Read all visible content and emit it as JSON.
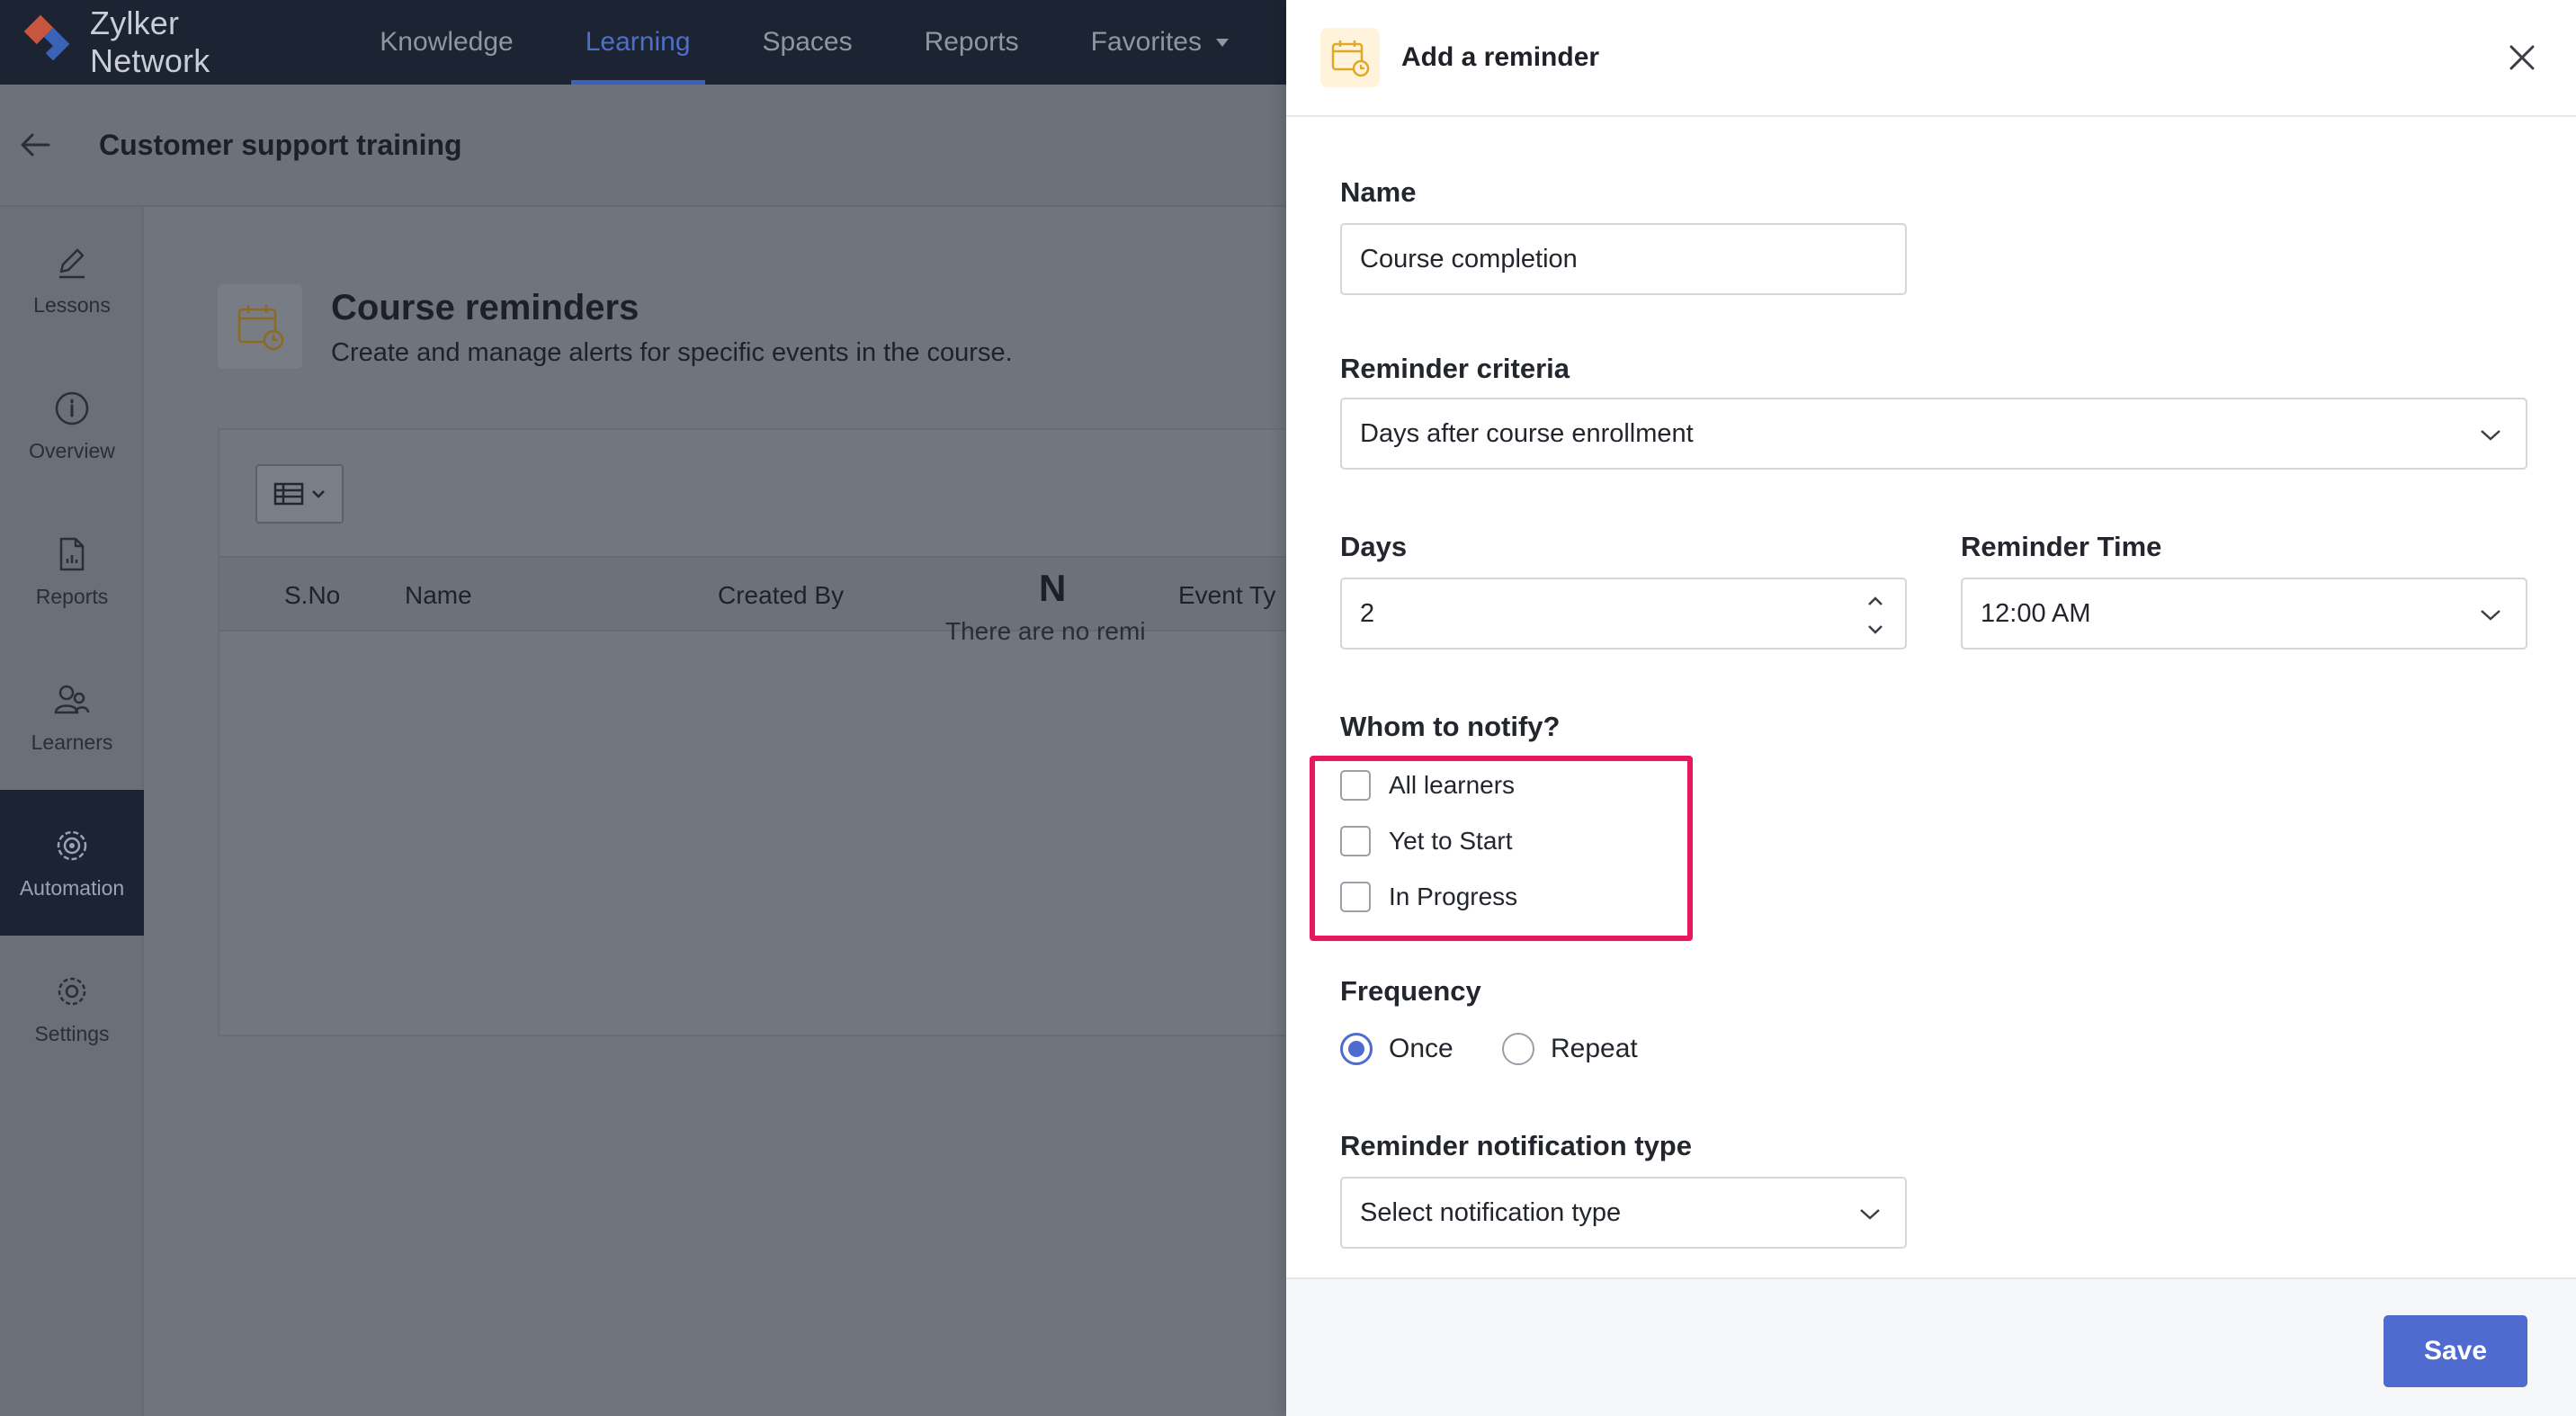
{
  "app": {
    "brand": "Zylker Network",
    "nav_tabs": [
      "Knowledge",
      "Learning",
      "Spaces",
      "Reports",
      "Favorites"
    ],
    "active_tab": "Learning"
  },
  "subheader": {
    "title": "Customer support training"
  },
  "sidebar": {
    "items": [
      {
        "label": "Lessons",
        "icon": "pencil-icon"
      },
      {
        "label": "Overview",
        "icon": "info-icon"
      },
      {
        "label": "Reports",
        "icon": "report-icon"
      },
      {
        "label": "Learners",
        "icon": "learners-icon"
      },
      {
        "label": "Automation",
        "icon": "automation-icon"
      },
      {
        "label": "Settings",
        "icon": "gear-icon"
      }
    ],
    "active": "Automation"
  },
  "main": {
    "title": "Course reminders",
    "subtitle": "Create and manage alerts for specific events in the course.",
    "columns": [
      "S.No",
      "Name",
      "Created By",
      "Event Ty"
    ],
    "empty_title": "N",
    "empty_subtitle": "There are no remi"
  },
  "drawer": {
    "title": "Add a reminder",
    "name_label": "Name",
    "name_value": "Course completion",
    "criteria_label": "Reminder criteria",
    "criteria_value": "Days after course enrollment",
    "days_label": "Days",
    "days_value": "2",
    "time_label": "Reminder Time",
    "time_value": "12:00 AM",
    "notify_label": "Whom to notify?",
    "notify_options": [
      "All learners",
      "Yet to Start",
      "In Progress"
    ],
    "frequency_label": "Frequency",
    "frequency_options": [
      "Once",
      "Repeat"
    ],
    "frequency_selected": "Once",
    "notification_type_label": "Reminder notification type",
    "notification_type_placeholder": "Select notification type",
    "save_label": "Save"
  },
  "colors": {
    "accent": "#4f6bd0",
    "highlight": "#e8185c",
    "topnav": "#1c2433"
  }
}
